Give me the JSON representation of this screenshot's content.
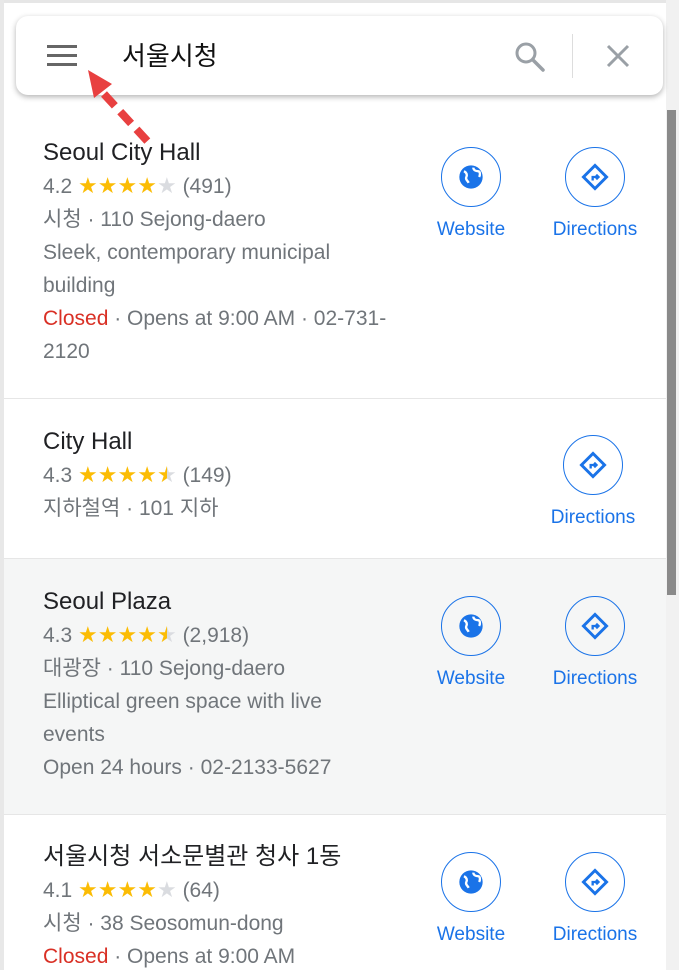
{
  "search": {
    "query": "서울시청",
    "menu_icon": "menu-icon",
    "search_icon": "search-icon",
    "close_icon": "close-icon"
  },
  "colors": {
    "accent": "#1a73e8",
    "star": "#fbbc04",
    "closed": "#d93025",
    "annotation_arrow": "#e84040"
  },
  "results": [
    {
      "name": "Seoul City Hall",
      "rating": "4.2",
      "stars": 4.2,
      "reviews": "(491)",
      "category_address": "시청 · 110 Sejong-daero",
      "description": "Sleek, contemporary municipal building",
      "status": "Closed",
      "hours": " · Opens at 9:00 AM · 02-731-2120",
      "website": "Website",
      "directions": "Directions"
    },
    {
      "name": "City Hall",
      "rating": "4.3",
      "stars": 4.3,
      "reviews": "(149)",
      "category_address": "지하철역 · 101 지하",
      "directions": "Directions"
    },
    {
      "name": "Seoul Plaza",
      "rating": "4.3",
      "stars": 4.3,
      "reviews": "(2,918)",
      "category_address": "대광장 · 110 Sejong-daero",
      "description": "Elliptical green space with live events",
      "hours": "Open 24 hours · 02-2133-5627",
      "website": "Website",
      "directions": "Directions"
    },
    {
      "name": "서울시청 서소문별관 청사 1동",
      "rating": "4.1",
      "stars": 4.1,
      "reviews": "(64)",
      "category_address": "시청 · 38 Seosomun-dong",
      "status": "Closed",
      "hours": " · Opens at 9:00 AM",
      "website": "Website",
      "directions": "Directions"
    }
  ]
}
